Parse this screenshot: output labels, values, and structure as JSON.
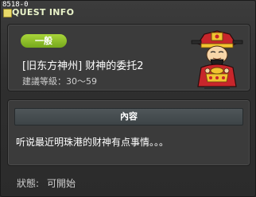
{
  "window": {
    "quest_id": "8518-0",
    "title": "QUEST INFO"
  },
  "quest": {
    "category": "一般",
    "name": "[旧东方神州] 财神的委托2",
    "level_label": "建議等級：",
    "level_range": "30～59",
    "npc_icon": "god-of-wealth-npc-icon"
  },
  "content": {
    "header": "內容",
    "text": "听说最近明珠港的财神有点事情。。。"
  },
  "status": {
    "label": "狀態:",
    "value": "可開始"
  },
  "colors": {
    "badge": "#8cc42a",
    "title_text": "#e9f3c9",
    "panel": "#3b3b3b",
    "content_header": "#475053"
  }
}
